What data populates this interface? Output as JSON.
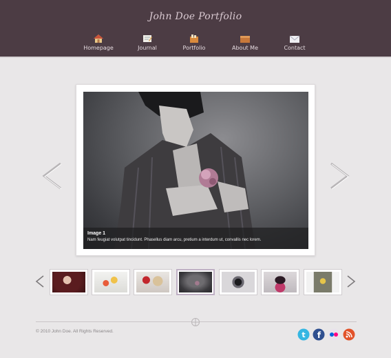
{
  "header": {
    "site_title": "John Doe Portfolio"
  },
  "nav": {
    "items": [
      {
        "label": "Homepage",
        "icon": "home-icon"
      },
      {
        "label": "Journal",
        "icon": "journal-icon"
      },
      {
        "label": "Portfolio",
        "icon": "portfolio-icon"
      },
      {
        "label": "About Me",
        "icon": "about-icon"
      },
      {
        "label": "Contact",
        "icon": "mail-icon"
      }
    ]
  },
  "slider": {
    "caption_title": "Image 1",
    "caption_text": "Nam feugiat volutpat tincidunt. Phasellus diam arcu, pretium a interdum ut, convallis nec lorem.",
    "active_index": 3
  },
  "thumbnails": [
    {
      "icon": "thumbnail-image"
    },
    {
      "icon": "thumbnail-image"
    },
    {
      "icon": "thumbnail-image"
    },
    {
      "icon": "thumbnail-image"
    },
    {
      "icon": "thumbnail-image"
    },
    {
      "icon": "thumbnail-image"
    },
    {
      "icon": "thumbnail-image"
    }
  ],
  "footer": {
    "copyright": "© 2010 John Doe. All Rights Reserved.",
    "social": [
      "twitter-icon",
      "facebook-icon",
      "flickr-icon",
      "rss-icon"
    ]
  },
  "colors": {
    "header_bg": "#4c3c44",
    "page_bg": "#e9e7e8",
    "accent": "#bfb0c4"
  }
}
